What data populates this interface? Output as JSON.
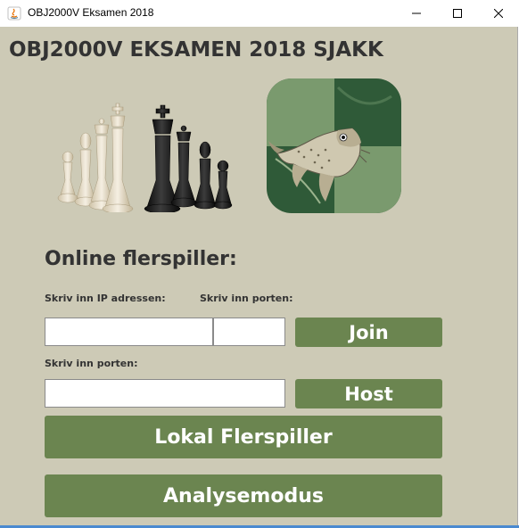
{
  "window": {
    "title": "OBJ2000V Eksamen 2018",
    "controls": {
      "minimize_icon": "minimize-icon",
      "maximize_icon": "maximize-icon",
      "close_icon": "close-icon"
    }
  },
  "header": {
    "title": "OBJ2000V EKSAMEN 2018 SJAKK"
  },
  "images": {
    "chess_pieces": "chess-pieces-image",
    "logo": "fish-logo-image"
  },
  "online": {
    "heading": "Online flerspiller:",
    "ip_label": "Skriv inn IP adressen:",
    "port_label": "Skriv inn porten:",
    "ip_value": "",
    "port_value": "",
    "join_label": "Join",
    "host_port_label": "Skriv inn porten:",
    "host_port_value": "",
    "host_label": "Host"
  },
  "local": {
    "label": "Lokal Flerspiller"
  },
  "analysis": {
    "label": "Analysemodus"
  },
  "colors": {
    "background": "#cdcab6",
    "button": "#6b8550",
    "button_text": "#ffffff",
    "text": "#333333"
  }
}
